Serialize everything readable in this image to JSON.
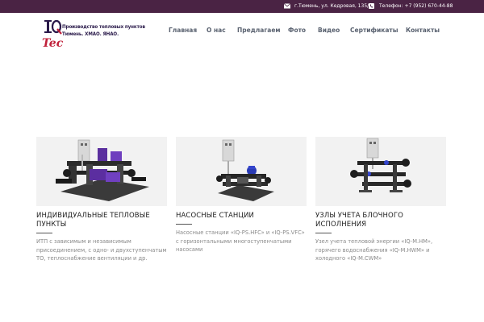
{
  "topbar": {
    "address_icon": "envelope-icon",
    "address": "г.Тюмень, ул. Кедровая, 135/2",
    "phone_icon": "phone-icon",
    "phone": "Телефон: +7 (952) 670-44-88"
  },
  "logo": {
    "mark_text": "IQ Tech",
    "line1": "Производство тепловых пунктов",
    "line2": "Тюмень. ХМАО. ЯНАО."
  },
  "nav": {
    "items": [
      "Главная",
      "О нас",
      "Предлагаем",
      "Фото",
      "Видео",
      "Сертификаты",
      "Контакты"
    ]
  },
  "colors": {
    "topbar": "#4a2344",
    "nav_text": "#5a6270",
    "logo_accent": "#c0203a",
    "logo_dark": "#2a1a4a"
  },
  "cards": [
    {
      "image": "heat-unit-image",
      "title": "ИНДИВИДУАЛЬНЫЕ ТЕПЛОВЫЕ ПУНКТЫ",
      "text": "ИТП с зависимым и независимым присоединением, с одно- и двухступенчатым ТО, теплоснабжение вентиляции и др."
    },
    {
      "image": "pump-station-image",
      "title": "НАСОСНЫЕ СТАНЦИИ",
      "text": "Насосные станции «IQ-PS.HFC» и «IQ-PS.VFC» с горизонтальными многоступенчатыми насосами"
    },
    {
      "image": "metering-unit-image",
      "title": "УЗЛЫ УЧЕТА БЛОЧНОГО ИСПОЛНЕНИЯ",
      "text": "Узел учета тепловой энергии «IQ-M.HM», горячего водоснабжения «IQ-M.HWM» и холодного «IQ-M.CWM»"
    }
  ]
}
